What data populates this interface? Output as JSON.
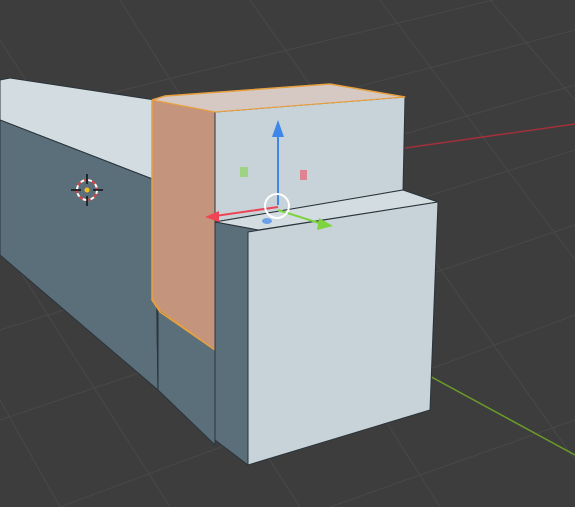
{
  "viewport": {
    "background": "#3d3d3d",
    "grid_color": "#4a4a4a",
    "axis_x_color": "#a0303a",
    "axis_y_color": "#6a9a2a"
  },
  "object": {
    "selected": true,
    "selection_outline_color": "#e6a040",
    "face_light": "#c7d3d8",
    "face_top": "#d3dde1",
    "face_side_dark": "#5b6f7b",
    "face_selected": "#c4947c"
  },
  "gizmo": {
    "mode": "move",
    "x_color": "#ee4456",
    "y_color": "#7ed340",
    "z_color": "#3e86e9"
  },
  "cursor_3d": {
    "visible": true
  }
}
